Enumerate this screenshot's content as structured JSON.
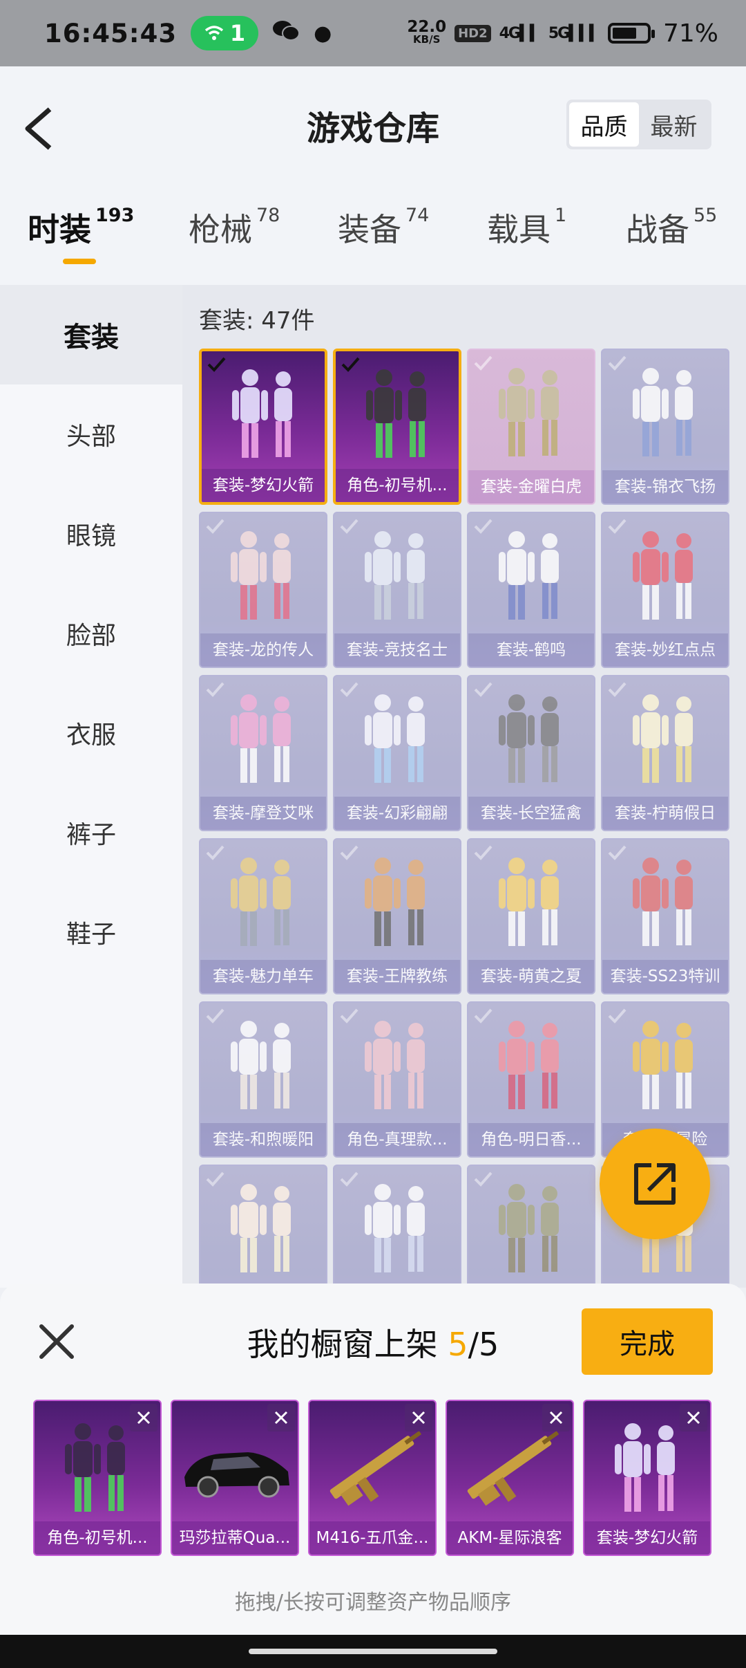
{
  "status_bar": {
    "time": "16:45:43",
    "wifi_badge": "1",
    "net_speed_value": "22.0",
    "net_speed_unit": "KB/S",
    "hd_label": "HD2",
    "signal_1": "4G",
    "signal_2": "5G",
    "battery_level": 0.71,
    "battery_pct": "71%"
  },
  "header": {
    "title": "游戏仓库",
    "sort_options": [
      "品质",
      "最新"
    ],
    "sort_active": "品质"
  },
  "tabs": [
    {
      "label": "时装",
      "count": "193",
      "active": true
    },
    {
      "label": "枪械",
      "count": "78",
      "active": false
    },
    {
      "label": "装备",
      "count": "74",
      "active": false
    },
    {
      "label": "载具",
      "count": "1",
      "active": false
    },
    {
      "label": "战备",
      "count": "55",
      "active": false
    }
  ],
  "sidebar": {
    "items": [
      "套装",
      "头部",
      "眼镜",
      "脸部",
      "衣服",
      "裤子",
      "鞋子"
    ],
    "active": "套装"
  },
  "grid": {
    "count_label": "套装: 47件",
    "items": [
      {
        "label": "套装-梦幻火箭",
        "selected": true
      },
      {
        "label": "角色-初号机...",
        "selected": true
      },
      {
        "label": "套装-金曜白虎",
        "selected": false
      },
      {
        "label": "套装-锦衣飞扬",
        "selected": false
      },
      {
        "label": "套装-龙的传人",
        "selected": false
      },
      {
        "label": "套装-竞技名士",
        "selected": false
      },
      {
        "label": "套装-鹤鸣",
        "selected": false
      },
      {
        "label": "套装-妙红点点",
        "selected": false
      },
      {
        "label": "套装-摩登艾咪",
        "selected": false
      },
      {
        "label": "套装-幻彩翩翩",
        "selected": false
      },
      {
        "label": "套装-长空猛禽",
        "selected": false
      },
      {
        "label": "套装-柠萌假日",
        "selected": false
      },
      {
        "label": "套装-魅力单车",
        "selected": false
      },
      {
        "label": "套装-王牌教练",
        "selected": false
      },
      {
        "label": "套装-萌黄之夏",
        "selected": false
      },
      {
        "label": "套装-SS23特训",
        "selected": false
      },
      {
        "label": "套装-和煦暖阳",
        "selected": false
      },
      {
        "label": "角色-真理款...",
        "selected": false
      },
      {
        "label": "角色-明日香...",
        "selected": false
      },
      {
        "label": "套装-...冒险",
        "selected": false
      },
      {
        "label": "",
        "selected": false
      },
      {
        "label": "",
        "selected": false
      },
      {
        "label": "",
        "selected": false
      },
      {
        "label": "",
        "selected": false
      }
    ]
  },
  "showcase": {
    "title_prefix": "我的橱窗上架 ",
    "filled": "5",
    "separator_total": "/5",
    "done_label": "完成",
    "slots": [
      {
        "label": "角色-初号机...",
        "icon": "mecha-figure-icon"
      },
      {
        "label": "玛莎拉蒂Qua...",
        "icon": "car-icon"
      },
      {
        "label": "M416-五爪金...",
        "icon": "rifle-icon"
      },
      {
        "label": "AKM-星际浪客",
        "icon": "rifle-icon"
      },
      {
        "label": "套装-梦幻火箭",
        "icon": "outfit-pair-icon"
      }
    ],
    "hint": "拖拽/长按可调整资产物品顺序"
  },
  "colors": {
    "accent": "#f8ae12",
    "selected_card": "#7b2b97",
    "card_default": "#a4a4cc"
  }
}
